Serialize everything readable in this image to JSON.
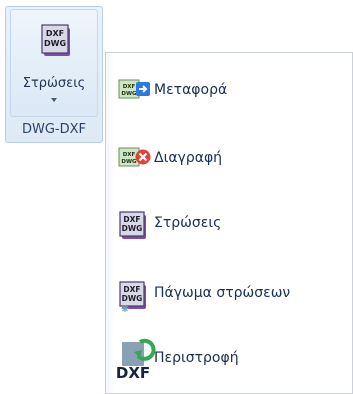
{
  "ribbon": {
    "button_label": "Στρώσεις",
    "group_label": "DWG-DXF",
    "icon": "dxf-dwg-layers-icon",
    "icon_text_top": "DXF",
    "icon_text_bottom": "DWG"
  },
  "menu": {
    "items": [
      {
        "label": "Μεταφορά",
        "icon": "dxf-dwg-transfer-icon"
      },
      {
        "label": "Διαγραφή",
        "icon": "dxf-dwg-delete-icon"
      },
      {
        "label": "Στρώσεις",
        "icon": "dxf-dwg-layers-icon"
      },
      {
        "label": "Πάγωμα στρώσεων",
        "icon": "dxf-dwg-freeze-layers-icon"
      },
      {
        "label": "Περιστροφή",
        "icon": "dxf-rotate-icon"
      }
    ]
  },
  "icon_text": {
    "dxf": "DXF",
    "dwg": "DWG"
  },
  "colors": {
    "label_text": "#1a2f55",
    "ribbon_bg": "#dde9f6",
    "delete_red": "#e2403b",
    "transfer_blue": "#2a7be0",
    "rotate_green": "#34a853"
  }
}
